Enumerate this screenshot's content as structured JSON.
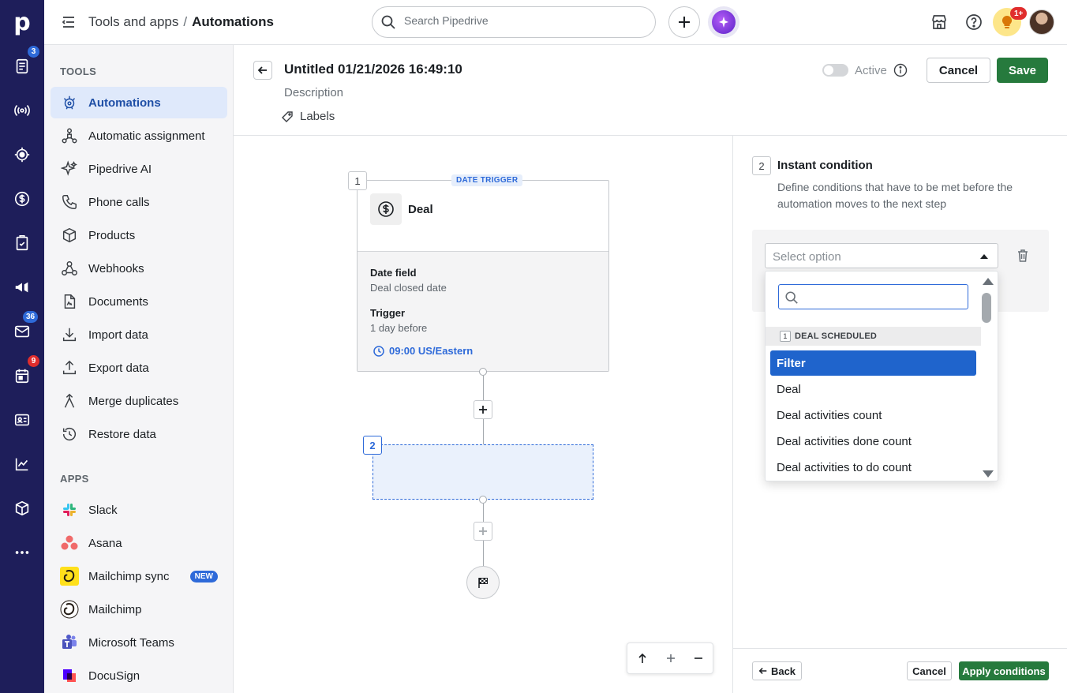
{
  "topbar": {
    "breadcrumb_parent": "Tools and apps",
    "breadcrumb_sep": "/",
    "breadcrumb_current": "Automations",
    "search_placeholder": "Search Pipedrive",
    "notif_badge": "1+"
  },
  "rail": {
    "logo": "p",
    "badges": {
      "leads": "3",
      "mail": "36",
      "activities": "9"
    },
    "items": [
      "leads-icon",
      "broadcast-icon",
      "target-icon",
      "deals-icon",
      "tasks-icon",
      "campaigns-icon",
      "mail-icon",
      "calendar-icon",
      "contacts-icon",
      "insights-icon",
      "products-icon",
      "more-icon"
    ]
  },
  "tools_sidebar": {
    "tools_title": "TOOLS",
    "tools": [
      {
        "label": "Automations",
        "icon": "automations-icon"
      },
      {
        "label": "Automatic assignment",
        "icon": "assignment-icon"
      },
      {
        "label": "Pipedrive AI",
        "icon": "ai-sparkle-icon"
      },
      {
        "label": "Phone calls",
        "icon": "phone-icon"
      },
      {
        "label": "Products",
        "icon": "box-icon"
      },
      {
        "label": "Webhooks",
        "icon": "webhooks-icon"
      },
      {
        "label": "Documents",
        "icon": "document-icon"
      },
      {
        "label": "Import data",
        "icon": "import-icon"
      },
      {
        "label": "Export data",
        "icon": "export-icon"
      },
      {
        "label": "Merge duplicates",
        "icon": "merge-icon"
      },
      {
        "label": "Restore data",
        "icon": "restore-icon"
      }
    ],
    "apps_title": "APPS",
    "apps": [
      {
        "label": "Slack",
        "icon": "slack-icon"
      },
      {
        "label": "Asana",
        "icon": "asana-icon"
      },
      {
        "label": "Mailchimp sync",
        "icon": "mailchimp-icon",
        "badge": "NEW"
      },
      {
        "label": "Mailchimp",
        "icon": "mailchimp-icon"
      },
      {
        "label": "Microsoft Teams",
        "icon": "teams-icon"
      },
      {
        "label": "DocuSign",
        "icon": "docusign-icon"
      }
    ]
  },
  "editor": {
    "title": "Untitled 01/21/2026 16:49:10",
    "description": "Description",
    "labels": "Labels",
    "active_label": "Active",
    "cancel": "Cancel",
    "save": "Save"
  },
  "canvas": {
    "node1": {
      "number": "1",
      "badge": "DATE TRIGGER",
      "entity": "Deal",
      "date_field_title": "Date field",
      "date_field_value": "Deal closed date",
      "trigger_title": "Trigger",
      "trigger_value": "1 day before",
      "time": "09:00 US/Eastern"
    },
    "node2": {
      "number": "2"
    }
  },
  "panel": {
    "step": "2",
    "title": "Instant condition",
    "description": "Define conditions that have to be met before the automation moves to the next step",
    "select_placeholder": "Select option",
    "dropdown": {
      "group_number": "1",
      "group_label": "DEAL SCHEDULED",
      "options": [
        "Filter",
        "Deal",
        "Deal activities count",
        "Deal activities done count",
        "Deal activities to do count"
      ],
      "selected_index": 0
    },
    "back": "Back",
    "cancel": "Cancel",
    "apply": "Apply conditions"
  },
  "colors": {
    "rail_bg": "#1e1e5a",
    "primary_green": "#267a3d",
    "accent_blue": "#2e6ad9",
    "selected_option_bg": "#1f64cc",
    "badge_red": "#e02d2d"
  }
}
